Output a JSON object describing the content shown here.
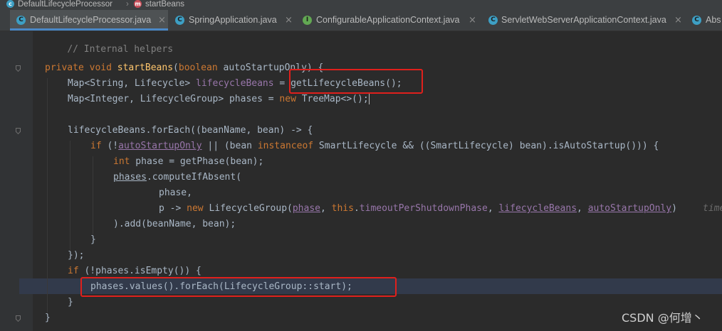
{
  "breadcrumb": {
    "items": [
      "DefaultLifecycleProcessor",
      "startBeans"
    ],
    "separator": "›"
  },
  "tabs": [
    {
      "label": "DefaultLifecycleProcessor.java",
      "icon": "C",
      "active": true
    },
    {
      "label": "SpringApplication.java",
      "icon": "C",
      "active": false
    },
    {
      "label": "ConfigurableApplicationContext.java",
      "icon": "I",
      "active": false
    },
    {
      "label": "ServletWebServerApplicationContext.java",
      "icon": "C",
      "active": false
    },
    {
      "label": "Abs",
      "icon": "C",
      "active": false
    }
  ],
  "tab_close_glyph": "×",
  "code": {
    "comment": "// Internal helpers",
    "kw_private": "private",
    "kw_void": "void",
    "method_name": "startBeans",
    "params": "(",
    "kw_boolean": "boolean",
    "param_name": " autoStartupOnly) {",
    "line2_type": "Map<String, Lifecycle> ",
    "line2_var": "lifecycleBeans",
    "line2_eq": " = ",
    "line2_call": "getLifecycleBeans();",
    "line3_type": "Map<Integer, LifecycleGroup> phases = ",
    "kw_new": "new",
    "line3_rest": " TreeMap<>();",
    "line5": "lifecycleBeans.forEach((beanName, bean) -> {",
    "kw_if": "if",
    "line6_a": " (!",
    "line6_field": "autoStartupOnly",
    "line6_b": " || (bean ",
    "kw_instanceof": "instanceof",
    "line6_c": " SmartLifecycle && ((SmartLifecycle) bean).isAutoStartup())) {",
    "kw_int": "int",
    "line7_rest": " phase = getPhase(bean);",
    "line8_var": "phases",
    "line8_rest": ".computeIfAbsent(",
    "line9": "phase,",
    "line10_a": "p -> ",
    "line10_b": " LifecycleGroup(",
    "line10_phase": "phase",
    "line10_comma": ", ",
    "kw_this": "this",
    "line10_dot": ".",
    "line10_timeout": "timeoutPerShutdownPhase",
    "line10_lb": "lifecycleBeans",
    "line10_aso": "autoStartupOnly",
    "line10_close": ")",
    "line10_hint": "time",
    "line11": ").add(beanName, bean);",
    "line12": "}",
    "line13": "});",
    "line14_rest": " (!phases.isEmpty()) {",
    "line15": "phases.values().forEach(LifecycleGroup::start);",
    "line16": "}",
    "line17": "}"
  },
  "watermark": "CSDN @何增丶"
}
